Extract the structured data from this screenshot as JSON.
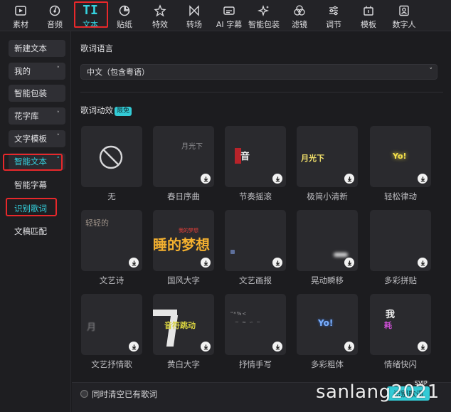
{
  "toolbar": {
    "items": [
      {
        "label": "素材",
        "icon": "media-icon"
      },
      {
        "label": "音频",
        "icon": "audio-icon"
      },
      {
        "label": "文本",
        "icon": "text-icon",
        "glyph": "TI"
      },
      {
        "label": "贴纸",
        "icon": "sticker-icon"
      },
      {
        "label": "特效",
        "icon": "effects-icon"
      },
      {
        "label": "转场",
        "icon": "transition-icon"
      },
      {
        "label": "AI 字幕",
        "icon": "ai-caption-icon"
      },
      {
        "label": "智能包装",
        "icon": "smart-package-icon"
      },
      {
        "label": "滤镜",
        "icon": "filter-icon"
      },
      {
        "label": "调节",
        "icon": "adjust-icon"
      },
      {
        "label": "模板",
        "icon": "template-icon"
      },
      {
        "label": "数字人",
        "icon": "digital-human-icon"
      }
    ],
    "active_index": 2
  },
  "sidebar": {
    "buttons": [
      {
        "label": "新建文本",
        "chevron": ""
      },
      {
        "label": "我的",
        "chevron": "˅"
      },
      {
        "label": "智能包装",
        "chevron": ""
      },
      {
        "label": "花字库",
        "chevron": "˅"
      },
      {
        "label": "文字模板",
        "chevron": "˅"
      },
      {
        "label": "智能文本",
        "chevron": "˄"
      }
    ],
    "links": [
      "智能字幕",
      "识别歌词",
      "文稿匹配"
    ]
  },
  "main": {
    "lyrics_language_title": "歌词语言",
    "language_value": "中文（包含粤语）",
    "animation_title": "歌词动效",
    "animation_badge": "限免",
    "cards": [
      {
        "name": "无",
        "preview": ""
      },
      {
        "name": "春日序曲",
        "preview": "月光下"
      },
      {
        "name": "节奏摇滚",
        "preview": "音"
      },
      {
        "name": "极简小清新",
        "preview": "月光下"
      },
      {
        "name": "轻松律动",
        "preview": "Yo!"
      },
      {
        "name": "文艺诗",
        "preview": "轻轻的"
      },
      {
        "name": "国风大字",
        "preview": "睡的梦想"
      },
      {
        "name": "文艺画报",
        "preview": ""
      },
      {
        "name": "晃动瞬移",
        "preview": ""
      },
      {
        "name": "多彩拼贴",
        "preview": ""
      },
      {
        "name": "文艺抒情歌",
        "preview": "月"
      },
      {
        "name": "黄白大字",
        "preview": "音符跳动"
      },
      {
        "name": "抒情手写",
        "preview": ""
      },
      {
        "name": "多彩粗体",
        "preview": "Yo!"
      },
      {
        "name": "情绪快闪",
        "preview": "我"
      }
    ]
  },
  "bottom": {
    "checkbox_label": "同时清空已有歌词",
    "start_label": "识别歌词",
    "svip": "SVIP"
  },
  "watermark": "sanlang2021",
  "colors": {
    "accent": "#35d3e0",
    "highlight_box": "#e8282b",
    "background": "#1c1c1f"
  }
}
